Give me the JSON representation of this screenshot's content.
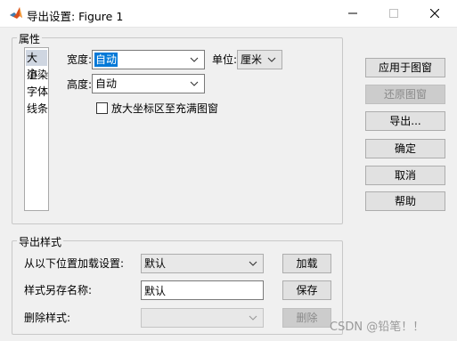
{
  "window": {
    "title": "导出设置: Figure 1",
    "controls": [
      "minimize-icon",
      "maximize-icon",
      "close-icon"
    ]
  },
  "properties": {
    "group_label": "属性",
    "categories": [
      {
        "label": "大小",
        "selected": true
      },
      {
        "label": "渲染",
        "selected": false
      },
      {
        "label": "字体",
        "selected": false
      },
      {
        "label": "线条",
        "selected": false
      }
    ],
    "width_label": "宽度:",
    "width_value": "自动",
    "unit_label": "单位:",
    "unit_value": "厘米",
    "height_label": "高度:",
    "height_value": "自动",
    "expand_axes_label": "放大坐标区至充满图窗",
    "expand_axes_checked": false
  },
  "right_buttons": {
    "apply": "应用于图窗",
    "restore": "还原图窗",
    "export": "导出...",
    "ok": "确定",
    "cancel": "取消",
    "help": "帮助"
  },
  "export_styles": {
    "group_label": "导出样式",
    "load_label": "从以下位置加载设置:",
    "load_value": "默认",
    "load_button": "加载",
    "save_label": "样式另存名称:",
    "save_value": "默认",
    "save_button": "保存",
    "delete_label": "删除样式:",
    "delete_value": "",
    "delete_button": "删除"
  },
  "watermark": "CSDN @铅笔！！",
  "colors": {
    "selection_highlight": "#0078d7",
    "list_selection": "#cfd6e1",
    "button_face": "#e1e1e1",
    "window_bg": "#f0f0f0"
  }
}
